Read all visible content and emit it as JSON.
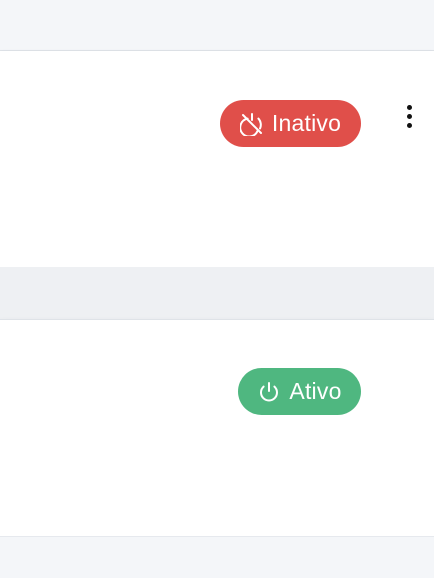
{
  "cards": [
    {
      "status": {
        "label": "Inativo",
        "icon": "power-off-icon",
        "color": "#e04f4a"
      },
      "menu_icon": "kebab-menu-icon"
    },
    {
      "status": {
        "label": "Ativo",
        "icon": "power-icon",
        "color": "#4fb780"
      }
    }
  ]
}
